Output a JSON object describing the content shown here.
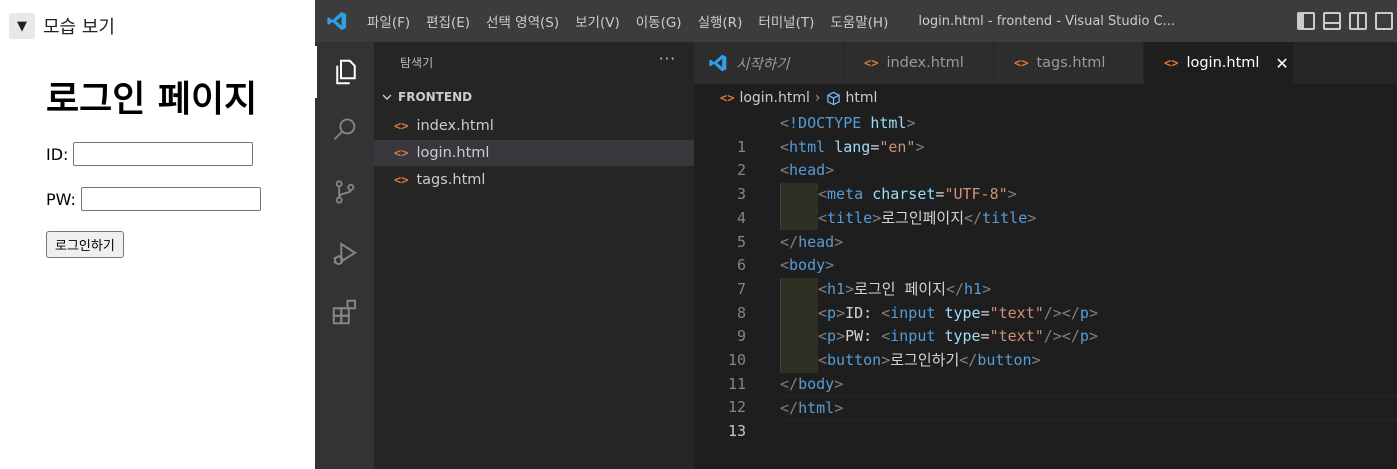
{
  "preview": {
    "toggle_arrow": "▼",
    "toggle_label": "모습 보기",
    "heading": "로그인 페이지",
    "id_label": "ID:",
    "pw_label": "PW:",
    "button_label": "로그인하기"
  },
  "titlebar": {
    "menus": [
      "파일(F)",
      "편집(E)",
      "선택 영역(S)",
      "보기(V)",
      "이동(G)",
      "실행(R)",
      "터미널(T)",
      "도움말(H)"
    ],
    "window_title": "login.html - frontend - Visual Studio C..."
  },
  "sidebar": {
    "title": "탐색기",
    "more": "···",
    "folder": "FRONTEND",
    "files": [
      "index.html",
      "login.html",
      "tags.html"
    ]
  },
  "tabs": [
    {
      "label": "시작하기"
    },
    {
      "label": "index.html"
    },
    {
      "label": "tags.html"
    },
    {
      "label": "login.html"
    }
  ],
  "breadcrumb": {
    "file": "login.html",
    "symbol": "html"
  },
  "editor": {
    "current_line": 13,
    "lines": [
      {
        "num": "1"
      },
      {
        "num": "2"
      },
      {
        "num": "3"
      },
      {
        "num": "4"
      },
      {
        "num": "5"
      },
      {
        "num": "6"
      },
      {
        "num": "7"
      },
      {
        "num": "8"
      },
      {
        "num": "9"
      },
      {
        "num": "10"
      },
      {
        "num": "11"
      },
      {
        "num": "12"
      },
      {
        "num": "13"
      }
    ],
    "code": {
      "doctype_kw": "!DOCTYPE",
      "html_tag": "html",
      "lang_attr": "lang",
      "lang_val": "\"en\"",
      "head_tag": "head",
      "meta_tag": "meta",
      "charset_attr": "charset",
      "charset_val": "\"UTF-8\"",
      "title_tag": "title",
      "title_text": "로그인페이지",
      "body_tag": "body",
      "h1_tag": "h1",
      "h1_text": "로그인 페이지",
      "p_tag": "p",
      "id_text": "ID: ",
      "pw_text": "PW: ",
      "input_tag": "input",
      "type_attr": "type",
      "type_val": "\"text\"",
      "button_tag": "button",
      "button_text": "로그인하기"
    }
  },
  "colors": {
    "accent_blue": "#007acc",
    "html_icon": "#e37933",
    "tag": "#569cd6",
    "attribute": "#9cdcfe",
    "string": "#ce9178"
  }
}
